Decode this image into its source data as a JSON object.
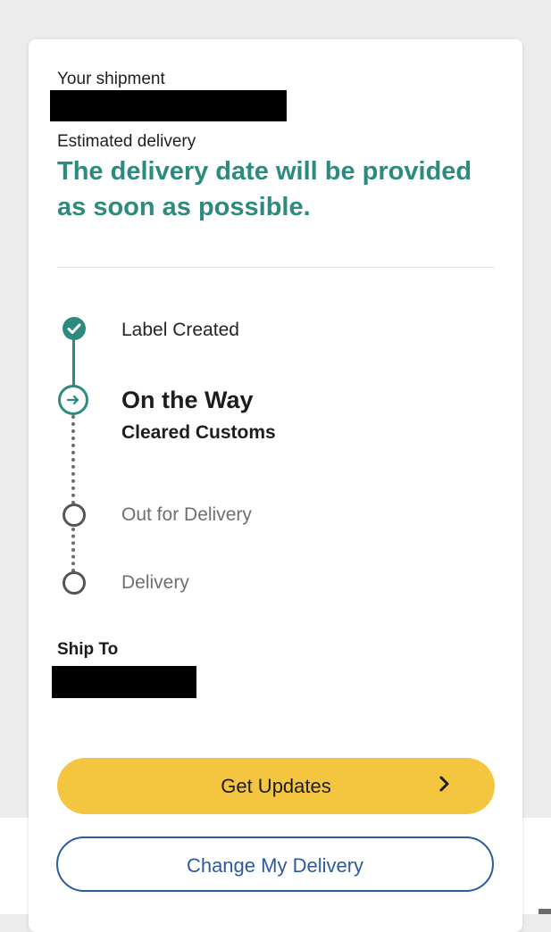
{
  "shipment": {
    "label": "Your shipment",
    "estimated_label": "Estimated delivery",
    "status_message": "The delivery date will be provided as soon as possible."
  },
  "tracking": {
    "steps": [
      {
        "title": "Label Created",
        "state": "done"
      },
      {
        "title": "On the Way",
        "subtitle": "Cleared Customs",
        "state": "current"
      },
      {
        "title": "Out for Delivery",
        "state": "pending"
      },
      {
        "title": "Delivery",
        "state": "pending"
      }
    ]
  },
  "ship_to": {
    "label": "Ship To"
  },
  "actions": {
    "get_updates": "Get Updates",
    "change_delivery": "Change My Delivery"
  },
  "colors": {
    "accent_teal": "#2e8a7e",
    "button_yellow": "#f4c53f",
    "link_blue": "#2c5aa0"
  }
}
